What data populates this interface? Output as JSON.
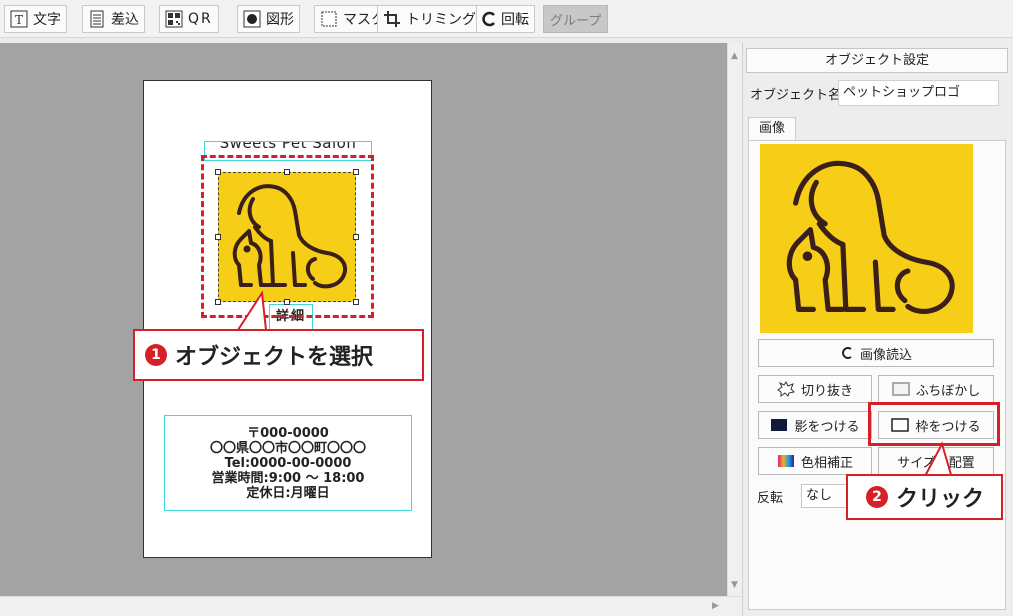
{
  "toolbar": {
    "text_label": "文字",
    "merge_label": "差込",
    "qr_label": "QR",
    "shape_label": "図形",
    "mask_label": "マスク",
    "trim_label": "トリミング",
    "rotate_label": "回転",
    "group_label": "グループ"
  },
  "card": {
    "title": "Sweets Pet Salon",
    "small_text": "詳細",
    "address_lines": [
      "〒000-0000",
      "〇〇県〇〇市〇〇町〇〇〇",
      "Tel:0000-00-0000",
      "営業時間:9:00 ～ 18:00",
      "定休日:月曜日"
    ]
  },
  "callouts": {
    "step1": "オブジェクトを選択",
    "step1_num": "1",
    "step2": "クリック",
    "step2_num": "2"
  },
  "panel": {
    "header": "オブジェクト設定",
    "name_label": "オブジェクト名",
    "name_value": "ペットショップロゴ",
    "tab_image": "画像",
    "reload_button": "画像読込",
    "crop_button": "切り抜き",
    "blur_button": "ふちぼかし",
    "shadow_button": "影をつける",
    "frame_button": "枠をつける",
    "hue_button": "色相補正",
    "size_button": "サイズと配置",
    "flip_label": "反転",
    "flip_value": "なし"
  },
  "colors": {
    "accent_red": "#d61f26",
    "logo_yellow": "#f6ce17",
    "logo_line": "#3a1f1a"
  }
}
